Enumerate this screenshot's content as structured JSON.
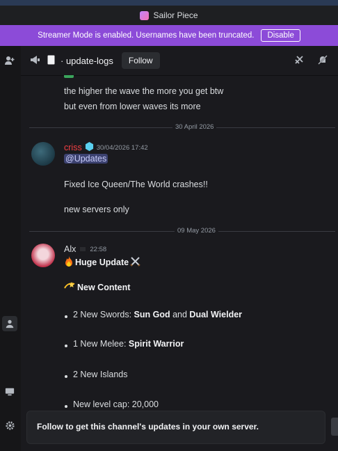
{
  "window": {
    "title": "Sailor Piece"
  },
  "banner": {
    "text": "Streamer Mode is enabled. Usernames have been truncated.",
    "button": "Disable"
  },
  "header": {
    "channel": "update-logs",
    "follow_label": "Follow"
  },
  "messages": {
    "continued_lines": [
      "the higher the wave the more you get btw",
      "but even from lower waves its more"
    ],
    "date1": "30 April 2026",
    "msg1": {
      "author": "criss",
      "timestamp": "30/04/2026 17:42",
      "mention": "@Updates",
      "line1": "Fixed Ice Queen/The World crashes!!",
      "line2": "new servers only"
    },
    "date2": "09 May 2026",
    "msg2": {
      "author": "Alx",
      "timestamp": "22:58",
      "heading": "Huge Update",
      "section": "New Content",
      "b1_prefix": "2 New Swords: ",
      "b1_bold1": "Sun God",
      "b1_mid": " and ",
      "b1_bold2": "Dual Wielder",
      "b2_prefix": "1 New Melee: ",
      "b2_bold": "Spirit Warrior",
      "b3": "2 New Islands",
      "b4": "New level cap: 20,000"
    }
  },
  "followbar": {
    "text": "Follow to get this channel's updates in your own server."
  },
  "colors": {
    "banner": "#8c4bd8",
    "author1": "#f23f43",
    "mention_bg": "#3c4270"
  }
}
